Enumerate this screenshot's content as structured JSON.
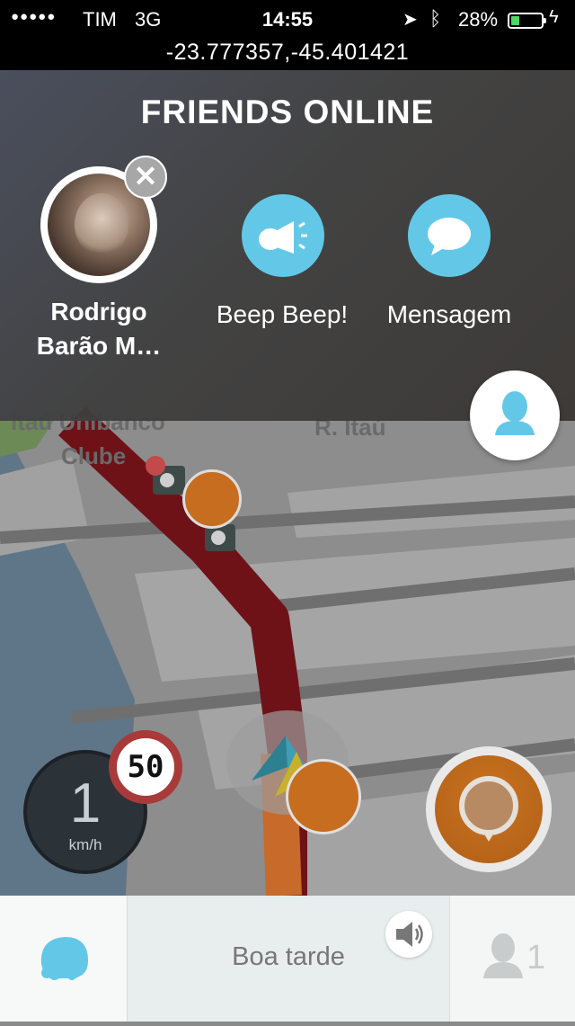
{
  "status_bar": {
    "signal": "●●●●●",
    "carrier": "TIM",
    "network": "3G",
    "time": "14:55",
    "battery_percent": "28%",
    "battery_level": 0.28,
    "coordinates": "-23.777357,-45.401421"
  },
  "friends_panel": {
    "title": "FRIENDS ONLINE",
    "friend_name": "Rodrigo Barão M…",
    "actions": [
      {
        "label": "Beep Beep!",
        "icon": "horn-icon"
      },
      {
        "label": "Mensagem",
        "icon": "chat-bubble-icon"
      }
    ],
    "close_glyph": "✕"
  },
  "map": {
    "labels": [
      "Itaú Unibanco",
      "Clube",
      "R. Itaú"
    ]
  },
  "speedometer": {
    "speed": "1",
    "unit": "km/h",
    "speed_limit": "50"
  },
  "bottom_bar": {
    "greeting": "Boa tarde",
    "friends_count": "1"
  },
  "colors": {
    "accent": "#63c8e8",
    "route": "#6e1218",
    "report": "#c9731f",
    "speed_limit_ring": "#a83a3a"
  }
}
